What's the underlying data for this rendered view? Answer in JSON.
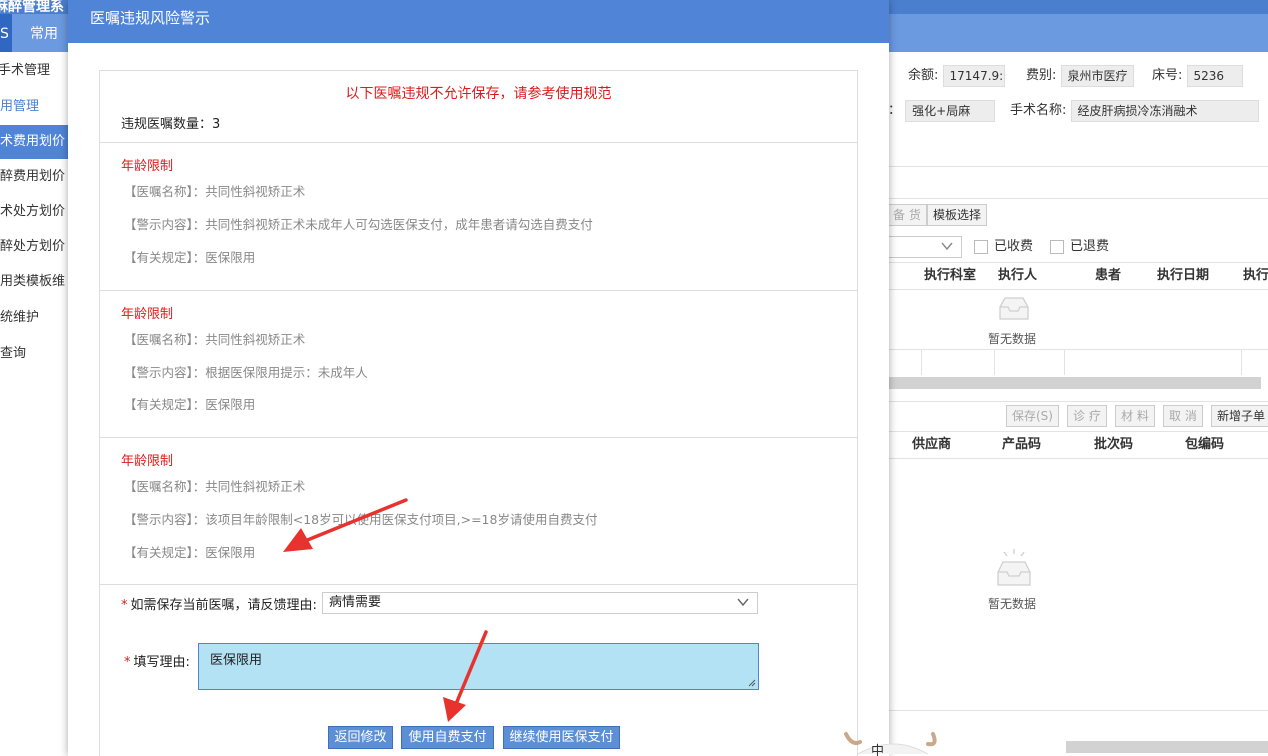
{
  "app": {
    "title": "麻醉管理系",
    "tabs": [
      "S",
      "常用"
    ]
  },
  "sidebar": {
    "items": [
      {
        "label": "手术管理"
      },
      {
        "label": "费用管理"
      },
      {
        "label": "手术费用划价"
      },
      {
        "label": "麻醉费用划价"
      },
      {
        "label": "手术处方划价"
      },
      {
        "label": "麻醉处方划价"
      },
      {
        "label": "使用类模板维"
      },
      {
        "label": "系统维护"
      },
      {
        "label": "查询"
      }
    ]
  },
  "patient": {
    "balance_label": "余额:",
    "balance_value": "17147.9:",
    "fee_type_label": "费别:",
    "fee_type_value": "泉州市医疗",
    "bed_label": "床号:",
    "bed_value": "5236",
    "anesthesia_suffix": "：",
    "anesthesia_value": "强化+局麻",
    "surgery_label": "手术名称:",
    "surgery_value": "经皮肝病损冷冻消融术"
  },
  "toolbar_top": {
    "stock_btn": "备 货",
    "template_btn": "模板选择",
    "paid_label": "已收费",
    "refunded_label": "已退费"
  },
  "grid1": {
    "columns": [
      "执行科室",
      "执行人",
      "患者",
      "执行日期",
      "执行"
    ],
    "empty_text": "暂无数据"
  },
  "toolbar_bottom": {
    "save": "保存(S)",
    "diagnose": "诊 疗",
    "material": "材 料",
    "cancel": "取 消",
    "new_sub": "新增子单"
  },
  "grid2": {
    "columns": [
      "供应商",
      "产品码",
      "批次码",
      "包编码"
    ],
    "empty_text": "暂无数据"
  },
  "modal": {
    "title": "医嘱违规风险警示",
    "notice": "以下医嘱违规不允许保存，请参考使用规范",
    "count_text": "违规医嘱数量：3",
    "sections": [
      {
        "title": "年龄限制",
        "order_name": "【医嘱名称】：共同性斜视矫正术",
        "warning": "【警示内容】：共同性斜视矫正术未成年人可勾选医保支付，成年患者请勾选自费支付",
        "rule": "【有关规定】：医保限用"
      },
      {
        "title": "年龄限制",
        "order_name": "【医嘱名称】：共同性斜视矫正术",
        "warning": "【警示内容】：根据医保限用提示：未成年人",
        "rule": "【有关规定】：医保限用"
      },
      {
        "title": "年龄限制",
        "order_name": "【医嘱名称】：共同性斜视矫正术",
        "warning": "【警示内容】：该项目年龄限制<18岁可以使用医保支付项目,>=18岁请使用自费支付",
        "rule": "【有关规定】：医保限用"
      }
    ],
    "reason_select_label": "如需保存当前医嘱，请反馈理由:",
    "reason_select_value": "病情需要",
    "reason_text_label": "填写理由:",
    "reason_text_value": "医保限用",
    "buttons": {
      "back": "返回修改",
      "self_pay": "使用自费支付",
      "insurance_pay": "继续使用医保支付"
    }
  },
  "colors": {
    "header_blue": "#4f84d6",
    "button_blue": "#5d8fd7",
    "alert_red": "#e01a1a",
    "textarea_bg": "#b3e2f5",
    "arrow_red": "#e8322e"
  },
  "icons": [
    "inbox-empty-icon",
    "chevron-down-icon",
    "arrow-annotation",
    "resize-grip-icon"
  ]
}
